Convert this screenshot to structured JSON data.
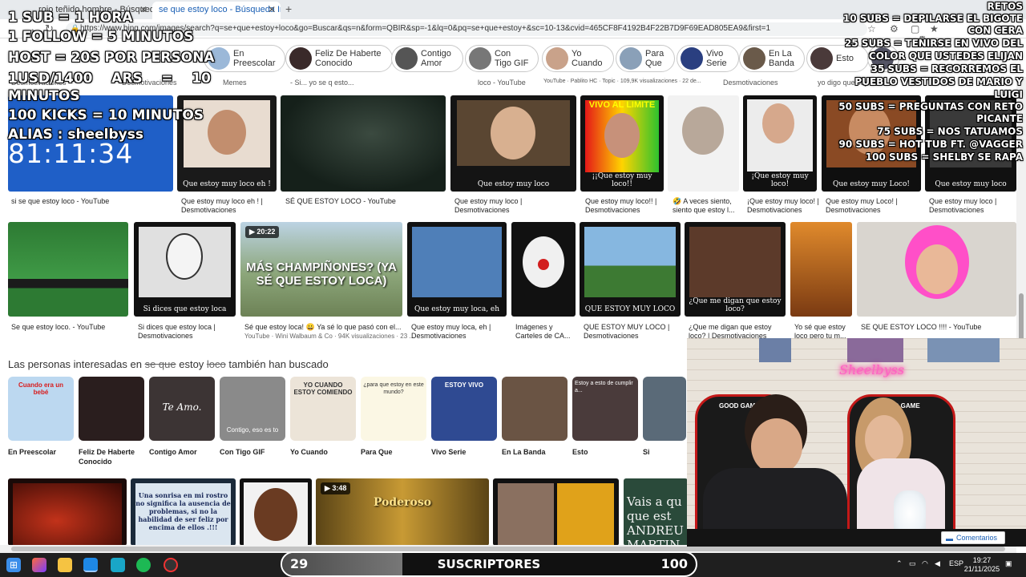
{
  "browser": {
    "tabs": [
      {
        "label": "rojo teñido hombre - Búsqueda"
      },
      {
        "label": "se que estoy loco - Búsqueda Im..."
      }
    ],
    "url": "https://www.bing.com/images/search?q=se+que+estoy+loco&go=Buscar&qs=n&form=QBIR&sp=-1&lq=0&pq=se+que+estoy+&sc=10-13&cvid=465CF8F4192B4F22B7D9F69EAD805EA9&first=1"
  },
  "chips": [
    {
      "label": "En Preescolar"
    },
    {
      "label": "Feliz De Haberte Conocido"
    },
    {
      "label": "Contigo Amor"
    },
    {
      "label": "Con Tigo GIF"
    },
    {
      "label": "Yo Cuando"
    },
    {
      "label": "Para Que"
    },
    {
      "label": "Vivo Serie"
    },
    {
      "label": "En La Banda"
    },
    {
      "label": "Esto"
    }
  ],
  "top_partial": [
    {
      "text": "Desmotivaciones"
    },
    {
      "text": "Memes"
    },
    {
      "text": "- Si... yo se q esto..."
    },
    {
      "text": "loco - YouTube"
    },
    {
      "text": "YouTube · Pablito HC · Topic · 109,9K visualizaciones · 22 de..."
    },
    {
      "text": "Desmotivaciones"
    },
    {
      "text": "yo digo que soy feliz..."
    }
  ],
  "row1": [
    {
      "title": "si se que estoy loco - YouTube"
    },
    {
      "title": "Que estoy muy loco eh ! | Desmotivaciones",
      "caption": "Que estoy muy loco eh !"
    },
    {
      "title": "SÉ QUE ESTOY LOCO - YouTube"
    },
    {
      "title": "Que estoy muy loco | Desmotivaciones",
      "caption": "Que estoy muy loco"
    },
    {
      "title": "Que estoy muy loco!! | Desmotivaciones",
      "banner": "VIVO AL LIMITE",
      "caption": "¡¡Que estoy muy loco!!"
    },
    {
      "title": "🤣 A veces siento, siento que estoy l..."
    },
    {
      "title": "¡Que estoy muy loco! | Desmotivaciones",
      "caption": "¡Que estoy muy loco!"
    },
    {
      "title": "Que estoy muy Loco! | Desmotivaciones",
      "caption": "Que estoy muy Loco!"
    },
    {
      "title": "Que estoy muy loco | Desmotivaciones",
      "caption": "Que estoy muy loco"
    }
  ],
  "row2": [
    {
      "title": "Se que estoy loco. - YouTube"
    },
    {
      "title": "Si dices que estoy loca | Desmotivaciones",
      "caption": "Si dices que estoy loca"
    },
    {
      "title": "Sé que estoy loca! 😀 Ya sé lo que pasó con el...",
      "meta": "YouTube · Wini Walbaum & Co · 94K visualizaciones · 23 ...",
      "duration": "▶ 20:22",
      "big": "MÁS CHAMPIÑONES? (YA SÉ QUE ESTOY LOCA)"
    },
    {
      "title": "Que estoy muy loca, eh | Desmotivaciones",
      "caption": "Que estoy muy loca, eh"
    },
    {
      "title": "Imágenes y Carteles de CA..."
    },
    {
      "title": "QUE ESTOY MUY LOCO | Desmotivaciones",
      "caption": "QUE ESTOY MUY LOCO"
    },
    {
      "title": "¿Que me digan que estoy loco? | Desmotivaciones",
      "caption": "¿Que me digan que estoy loco?"
    },
    {
      "title": "Yo sé que estoy loco pero tu m..."
    },
    {
      "title": "SE QUE ESTOY LOCO !!!! - YouTube"
    }
  ],
  "related": {
    "heading_pre": "Las personas interesadas en ",
    "heading_s1": "se que",
    "heading_mid": " estoy ",
    "heading_s2": "loco",
    "heading_post": " también han buscado",
    "items": [
      {
        "label": "En Preescolar",
        "thumb_text": "Cuando era un bebé"
      },
      {
        "label": "Feliz De Haberte Conocido"
      },
      {
        "label": "Contigo Amor",
        "thumb_text": "Te Amo."
      },
      {
        "label": "Con Tigo GIF",
        "thumb_text": "Contigo, eso es to"
      },
      {
        "label": "Yo Cuando",
        "thumb_text": "YO CUANDO ESTOY COMIENDO"
      },
      {
        "label": "Para Que",
        "thumb_text": "¿para que estoy en este mundo?"
      },
      {
        "label": "Vivo Serie",
        "thumb_text": "ESTOY VIVO"
      },
      {
        "label": "En La Banda"
      },
      {
        "label": "Esto",
        "thumb_text": "Estoy a esto de cumplir a..."
      },
      {
        "label": "Si"
      }
    ]
  },
  "row3": [
    {
      "caption": "Una sonrisa en mi rostro no significa la ausencia de problemas, si no la habilidad de ser feliz por encima de ellos .!!!"
    },
    {
      "duration": "▶ 3:48",
      "big": "Poderoso"
    },
    {
      "caption": "Vais a qu que est ANDREU MARTIN"
    }
  ],
  "overlay_left": [
    {
      "text": "1 SUB = 1 HORA"
    },
    {
      "text": "1 FOLLOW = 5 MINUTOS"
    },
    {
      "text": "HOST = 20S POR PERSONA"
    },
    {
      "text": "1USD/1400    ARS    =    10"
    },
    {
      "text": "MINUTOS"
    },
    {
      "text": "100 KICKS = 10 MINUTOS"
    },
    {
      "text": "ALIAS : sheelbyss"
    }
  ],
  "timer": "81:11:34",
  "overlay_right": [
    {
      "text": "RETOS"
    },
    {
      "text": "10 SUBS = DEPILARSE EL BIGOTE"
    },
    {
      "text": "CON CERA"
    },
    {
      "text": "25 SUBS = TEÑIRSE EN VIVO DEL"
    },
    {
      "text": "COLOR QUE USTEDES ELIJAN"
    },
    {
      "text": "35 SUBS = RECORREMOS EL"
    },
    {
      "text": "PUEBLO VESTIDOS DE MARIO Y"
    },
    {
      "text": "LUIGI"
    },
    {
      "text": "50 SUBS = PREGUNTAS CON RETO"
    },
    {
      "text": "PICANTE"
    },
    {
      "text": "75 SUBS = NOS TATUAMOS"
    },
    {
      "text": "90 SUBS  = HOT TUB FT. @VAGGER"
    },
    {
      "text": "100 SUBS = SHELBY SE RAPA"
    }
  ],
  "webcam": {
    "neon": "Sheelbyss",
    "chair_text": "GOOD GAME"
  },
  "comentarios": "Comentarios",
  "subbar": {
    "current": "29",
    "label": "SUSCRIPTORES",
    "goal": "100",
    "progress": 0.29
  },
  "taskbar": {
    "lang": "ESP",
    "time": "19:27",
    "date": "21/11/2025"
  },
  "colors": {
    "accent": "#1a5fb4",
    "taskbar": "#1f1f1f",
    "neon": "#ff62c4"
  }
}
